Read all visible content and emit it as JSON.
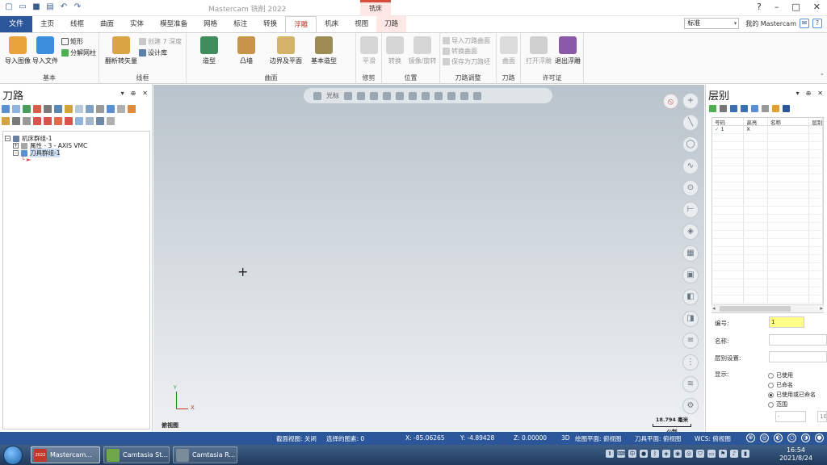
{
  "app": {
    "title": "Mastercam 铣削 2022",
    "context_tab_group": "铣床"
  },
  "qat": [
    "new-icon",
    "open-icon",
    "save-icon",
    "print-icon",
    "undo-icon",
    "redo-icon"
  ],
  "window_controls": {
    "help": "?",
    "minimize": "–",
    "maximize": "□",
    "close": "✕"
  },
  "tabs": {
    "file": "文件",
    "items": [
      "主页",
      "线框",
      "曲面",
      "实体",
      "模型准备",
      "网格",
      "标注",
      "转换",
      "浮雕",
      "机床",
      "视图",
      "刀路"
    ],
    "active": "浮雕"
  },
  "topright": {
    "combo_value": "标准",
    "my_mastercam": "我的 Mastercam"
  },
  "ribbon": {
    "groups": {
      "basic": "基本",
      "wireframe": "线框",
      "surface": "曲面",
      "trim": "修剪",
      "position": "位置",
      "toolpath_adjust": "刀路调整",
      "toolpath": "刀路",
      "license": "许可证"
    },
    "buttons": {
      "import_image": "导入图像",
      "import_file": "导入文件",
      "rectangle": "矩形",
      "decompose_mesh": "分解网柱",
      "line_to_vector": "翻析转矢量",
      "create_7_depth": "创建 7 深度",
      "design_library": "设计库",
      "shape": "造型",
      "extrude": "凸墙",
      "boundary_plane": "边界及平面",
      "basic_shape": "基本造型",
      "plane": "平滑",
      "transform": "转换",
      "mirror_rotate": "镜像/旋转",
      "import_toolpath_surface": "导入刀路曲面",
      "convert_surface": "转换曲面",
      "save_as_blank": "保存为刀路坯",
      "surface": "曲面",
      "open_relief": "打开浮雕",
      "exit_relief": "退出浮雕"
    }
  },
  "toolpath_panel": {
    "title": "刀路",
    "tree": {
      "machine_group": "机床群组-1",
      "properties": "属性 - 3 - AXIS VMC",
      "toolpath_group": "刀具群组-1"
    }
  },
  "graphics": {
    "hud_label": "光标",
    "view_name": "俯视图",
    "scale_value": "18.794 毫米",
    "scale_unit": "公制",
    "axis_x": "X",
    "axis_y": "Y"
  },
  "levels_panel": {
    "title": "层别",
    "columns": [
      "号码",
      "高亮",
      "名称",
      "层别"
    ],
    "rows": [
      {
        "number": "1",
        "highlight": "X",
        "name": ""
      }
    ],
    "number_label": "编号:",
    "number_value": "1",
    "name_label": "名称:",
    "level_set_label": "层别设置:",
    "display_label": "显示:",
    "options": [
      "已使用",
      "已命名",
      "已使用或已命名",
      "范围"
    ],
    "selected_option": 2,
    "range_from": "-",
    "range_to": "100"
  },
  "statusbar": {
    "section_view": "截面视图: 关闭",
    "selected": "选择的图素: 0",
    "x": "X:  -85.06265",
    "y": "Y:  -4.89428",
    "z": "Z:  0.00000",
    "mode": "3D",
    "draw_plane": "绘图平面: 俯视图",
    "tool_plane": "刀具平面: 俯视图",
    "wcs": "WCS: 俯视图"
  },
  "taskbar": {
    "items": [
      "Mastercam...",
      "Camtasia St...",
      "Camtasia R..."
    ],
    "app_badge": "2022",
    "time": "16:54",
    "date": "2021/8/24"
  },
  "colors": {
    "accent": "#2b579a",
    "active_tab_text": "#c0392b",
    "context_tab_bg": "#fde8e6",
    "highlight_input": "#ffff88"
  }
}
